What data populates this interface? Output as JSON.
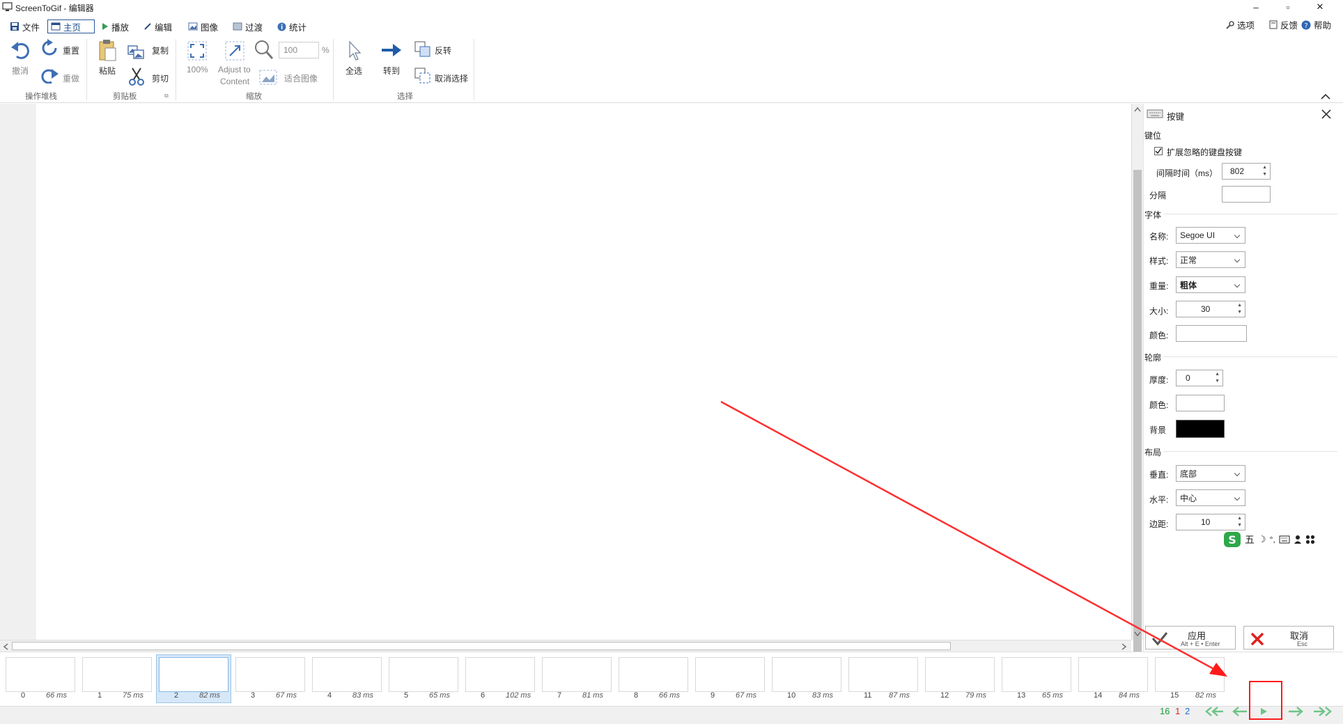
{
  "window": {
    "title": "ScreenToGif - 编辑器",
    "minimize": "–",
    "maximize": "▫",
    "close": "✕"
  },
  "menu": {
    "items": [
      {
        "label": "文件",
        "icon": "save-icon"
      },
      {
        "label": "主页",
        "icon": "home-icon",
        "active": true
      },
      {
        "label": "播放",
        "icon": "play-icon"
      },
      {
        "label": "编辑",
        "icon": "pencil-icon"
      },
      {
        "label": "图像",
        "icon": "image-icon"
      },
      {
        "label": "过渡",
        "icon": "transition-icon"
      },
      {
        "label": "统计",
        "icon": "info-icon"
      }
    ],
    "right": [
      {
        "label": "选项",
        "icon": "wrench-icon"
      },
      {
        "label": "反馈",
        "icon": "feedback-icon"
      },
      {
        "label": "帮助",
        "icon": "help-icon"
      }
    ]
  },
  "ribbon": {
    "undo": "撤消",
    "redo": "重做",
    "reset": "重置",
    "group_history": "操作堆栈",
    "paste": "粘贴",
    "copy": "复制",
    "cut": "剪切",
    "group_clipboard": "剪贴板",
    "zoom100": "100%",
    "adjust": "Adjust to",
    "adjust2": "Content",
    "zoom_value": "100",
    "zoom_unit": "%",
    "fit_image": "适合图像",
    "group_zoom": "缩放",
    "select_all": "全选",
    "goto": "转到",
    "invert": "反转",
    "deselect": "取消选择",
    "group_select": "选择"
  },
  "panel": {
    "title": "按键",
    "section_keys": "键位",
    "extended_keys": "扩展忽略的键盘按键",
    "interval_label": "间隔时间（ms）",
    "interval_value": "802",
    "separator_label": "分隔",
    "separator_value": "",
    "section_font": "字体",
    "font_name_label": "名称:",
    "font_name_value": "Segoe UI",
    "font_style_label": "样式:",
    "font_style_value": "正常",
    "font_weight_label": "重量:",
    "font_weight_value": "粗体",
    "font_size_label": "大小:",
    "font_size_value": "30",
    "font_color_label": "颜色:",
    "section_outline": "轮廓",
    "outline_thickness_label": "厚度:",
    "outline_thickness_value": "0",
    "outline_color_label": "颜色:",
    "background_label": "背景",
    "section_layout": "布局",
    "vertical_label": "垂直:",
    "vertical_value": "底部",
    "horizontal_label": "水平:",
    "horizontal_value": "中心",
    "margin_label": "边距:",
    "margin_value": "10",
    "ime_mode": "五",
    "apply_label": "应用",
    "apply_shortcut": "Alt + E • Enter",
    "cancel_label": "取消",
    "cancel_shortcut": "Esc"
  },
  "frames": [
    {
      "index": "0",
      "delay": "66 ms"
    },
    {
      "index": "1",
      "delay": "75 ms"
    },
    {
      "index": "2",
      "delay": "82 ms",
      "selected": true
    },
    {
      "index": "3",
      "delay": "67 ms"
    },
    {
      "index": "4",
      "delay": "83 ms"
    },
    {
      "index": "5",
      "delay": "65 ms"
    },
    {
      "index": "6",
      "delay": "102 ms"
    },
    {
      "index": "7",
      "delay": "81 ms"
    },
    {
      "index": "8",
      "delay": "66 ms"
    },
    {
      "index": "9",
      "delay": "67 ms"
    },
    {
      "index": "10",
      "delay": "83 ms"
    },
    {
      "index": "11",
      "delay": "87 ms"
    },
    {
      "index": "12",
      "delay": "79 ms"
    },
    {
      "index": "13",
      "delay": "65 ms"
    },
    {
      "index": "14",
      "delay": "84 ms"
    },
    {
      "index": "15",
      "delay": "82 ms"
    }
  ],
  "status": {
    "frame_count": "16",
    "selected_count": "1",
    "current_frame": "2"
  },
  "colors": {
    "accent": "#1e6fd0",
    "annotation": "#ff1a1a",
    "nav_arrow": "#5fbf7a",
    "count_green": "#1a9e3a",
    "count_red": "#e0202a",
    "count_blue": "#1e6fd0"
  }
}
